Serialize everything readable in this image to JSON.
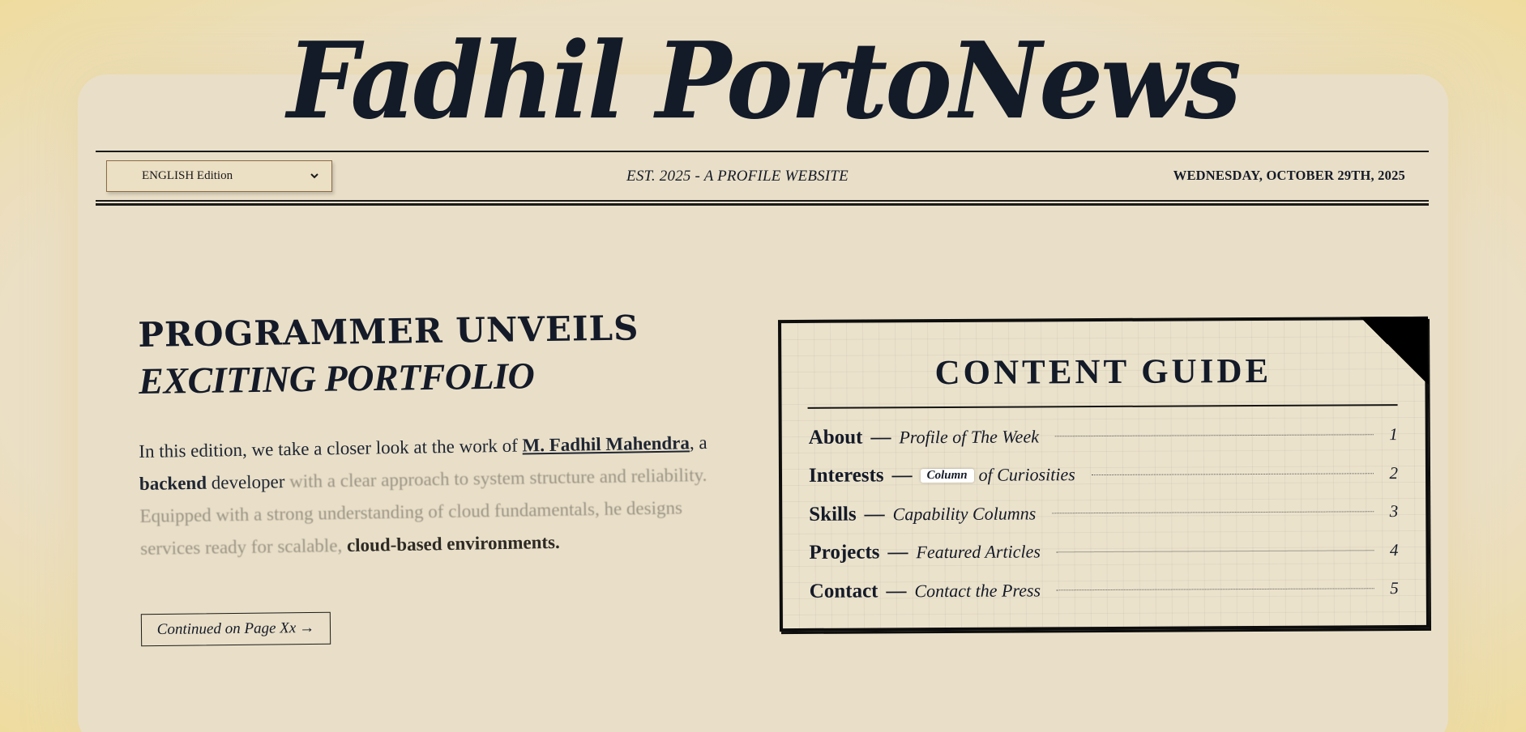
{
  "masthead": {
    "title": "Fadhil PortoNews"
  },
  "header": {
    "edition_label": "ENGLISH Edition",
    "tagline": "EST. 2025 - A PROFILE WEBSITE",
    "date": "WEDNESDAY, OCTOBER 29TH, 2025"
  },
  "article": {
    "headline_line1": "PROGRAMMER UNVEILS",
    "headline_line2": "EXCITING PORTFOLIO",
    "lede": {
      "part1": "In this edition, we take a closer look at the work of ",
      "name": "M. Fadhil Mahendra",
      "part2": ", a ",
      "role": "backend",
      "part3": " developer ",
      "faded": "with a clear approach to system structure and reliability. Equipped with a strong understanding of cloud fundamentals, he designs services ready for scalable,",
      "tail": " cloud-based environments."
    },
    "continued_label": "Continued on Page Xx",
    "continued_arrow": "→"
  },
  "content_guide": {
    "title": "CONTENT GUIDE",
    "items": [
      {
        "section": "About",
        "dash": "—",
        "desc": "Profile of The Week",
        "tag": "",
        "page": "1"
      },
      {
        "section": "Interests",
        "dash": "—",
        "desc": "of Curiosities",
        "tag": "Column",
        "page": "2"
      },
      {
        "section": "Skills",
        "dash": "—",
        "desc": "Capability Columns",
        "tag": "",
        "page": "3"
      },
      {
        "section": "Projects",
        "dash": "—",
        "desc": "Featured Articles",
        "tag": "",
        "page": "4"
      },
      {
        "section": "Contact",
        "dash": "—",
        "desc": "Contact the Press",
        "tag": "",
        "page": "5"
      }
    ]
  }
}
